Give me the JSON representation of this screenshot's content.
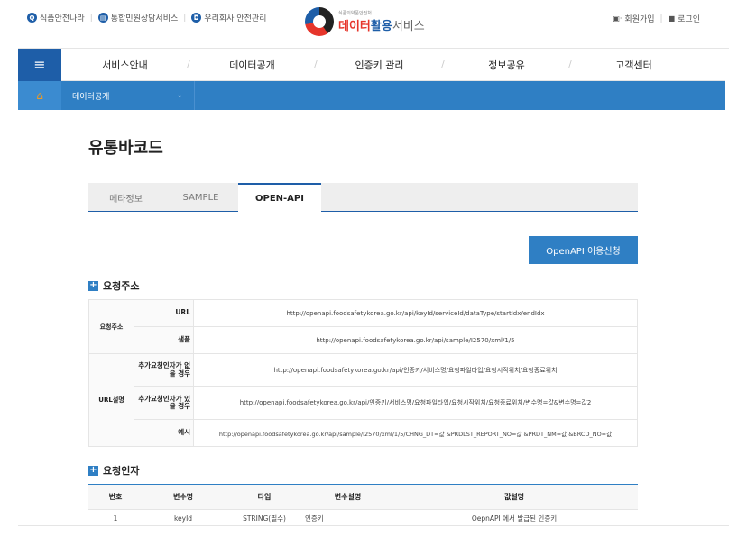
{
  "top_links": [
    {
      "icon": "search-icon",
      "glyph": "Q",
      "label": "식품안전나라"
    },
    {
      "icon": "document-icon",
      "glyph": "▤",
      "label": "통합민원상담서비스"
    },
    {
      "icon": "company-icon",
      "glyph": "◘",
      "label": "우리회사 안전관리"
    }
  ],
  "logo": {
    "small": "식품의약품안전처",
    "main_a": "데이터",
    "main_b": "활용",
    "main_c": "서비스"
  },
  "user_links": {
    "signup": "회원가입",
    "login": "로그인",
    "signup_icon": "▣·",
    "login_icon": "🔒"
  },
  "nav": {
    "menu_glyph": "≡",
    "items": [
      "서비스안내",
      "데이터공개",
      "인증키 관리",
      "정보공유",
      "고객센터"
    ]
  },
  "breadcrumb": {
    "home_glyph": "⌂",
    "current": "데이터공개",
    "chevron": "⌄"
  },
  "page_title": "유통바코드",
  "tabs": [
    {
      "label": "메타정보",
      "active": false
    },
    {
      "label": "SAMPLE",
      "active": false
    },
    {
      "label": "OPEN-API",
      "active": true
    }
  ],
  "apply_button": "OpenAPI 이용신청",
  "section_request": {
    "title": "요청주소",
    "group1": "요청주소",
    "url_label": "URL",
    "url_value": "http://openapi.foodsafetykorea.go.kr/api/keyId/serviceId/dataType/startIdx/endIdx",
    "sample_label": "샘플",
    "sample_value": "http://openapi.foodsafetykorea.go.kr/api/sample/I2570/xml/1/5",
    "group2": "URL설명",
    "no_extra_label": "추가요청인자가 없을 경우",
    "no_extra_value": "http://openapi.foodsafetykorea.go.kr/api/인증키/서비스명/요청파일타입/요청시작위치/요청종료위치",
    "extra_label": "추가요청인자가 있을 경우",
    "extra_value": "http://openapi.foodsafetykorea.go.kr/api/인증키/서비스명/요청파일타입/요청시작위치/요청종료위치/변수명=값&변수명=값2",
    "example_label": "예시",
    "example_value": "http://openapi.foodsafetykorea.go.kr/api/sample/I2570/xml/1/5/CHNG_DT=값 &PRDLST_REPORT_NO=값 &PRDT_NM=값 &BRCD_NO=값"
  },
  "section_params": {
    "title": "요청인자",
    "headers": [
      "번호",
      "변수명",
      "타입",
      "변수설명",
      "값설명"
    ],
    "rows": [
      [
        "1",
        "keyId",
        "STRING(필수)",
        "인증키",
        "OepnAPI 에서 발급된 인증키"
      ]
    ]
  }
}
